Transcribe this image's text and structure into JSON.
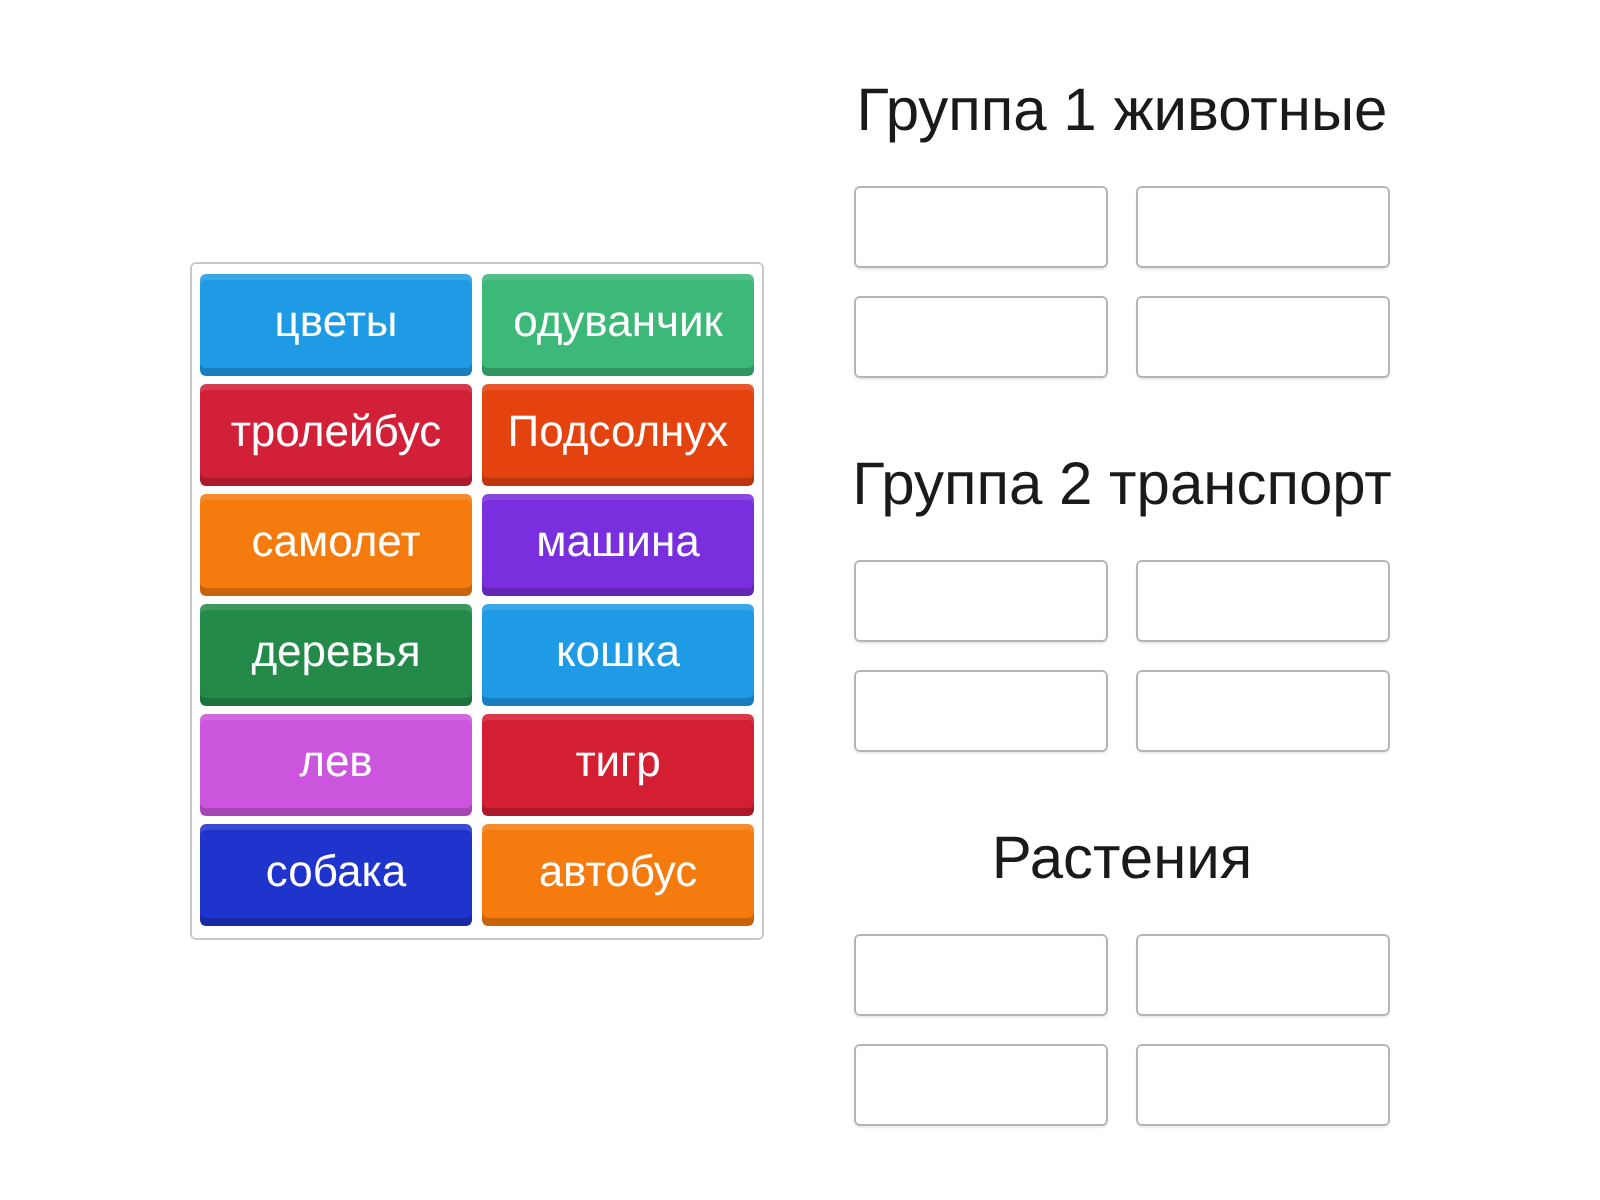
{
  "word_bank": {
    "tiles": [
      {
        "label": "цветы",
        "color": "#1f9be6"
      },
      {
        "label": "одуванчик",
        "color": "#3cb878"
      },
      {
        "label": "тролейбус",
        "color": "#d22038"
      },
      {
        "label": "Подсолнух",
        "color": "#e4420f"
      },
      {
        "label": "самолет",
        "color": "#f57b0f"
      },
      {
        "label": "машина",
        "color": "#7a2fde"
      },
      {
        "label": "деревья",
        "color": "#248a4a"
      },
      {
        "label": "кошка",
        "color": "#1f9be6"
      },
      {
        "label": "лев",
        "color": "#cb55dc"
      },
      {
        "label": "тигр",
        "color": "#d41e32"
      },
      {
        "label": "собака",
        "color": "#1f34cc"
      },
      {
        "label": "автобус",
        "color": "#f57b0f"
      }
    ]
  },
  "groups": [
    {
      "title": "Группа 1 животные",
      "slots": [
        {
          "filled": false
        },
        {
          "filled": false
        },
        {
          "filled": false
        },
        {
          "filled": false
        }
      ]
    },
    {
      "title": "Группа 2 транспорт",
      "slots": [
        {
          "filled": false
        },
        {
          "filled": false
        },
        {
          "filled": false
        },
        {
          "filled": false
        }
      ]
    },
    {
      "title": "Растения",
      "slots": [
        {
          "filled": false
        },
        {
          "filled": false
        },
        {
          "filled": false
        },
        {
          "filled": false
        }
      ]
    }
  ]
}
